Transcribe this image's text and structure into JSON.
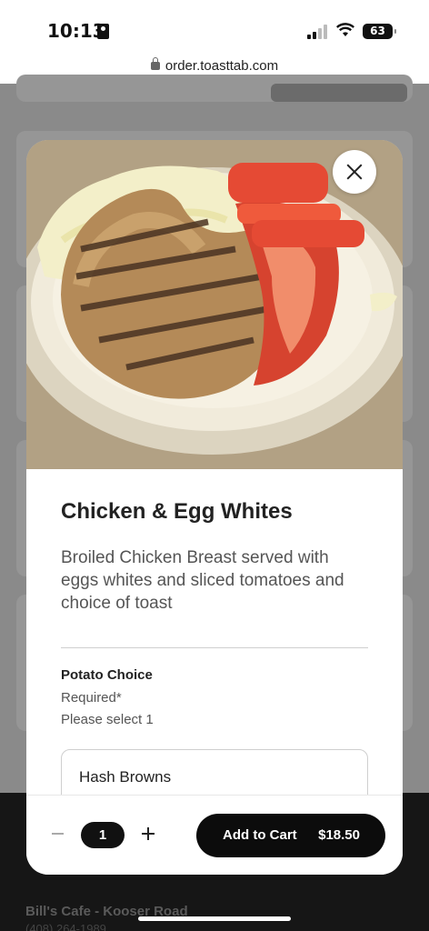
{
  "status": {
    "time": "10:13",
    "battery": "63"
  },
  "browser": {
    "url": "order.toasttab.com"
  },
  "background": {
    "restaurant": "Bill's Cafe - Kooser Road",
    "phone": "(408) 264-1989"
  },
  "item": {
    "title": "Chicken & Egg Whites",
    "description": "Broiled Chicken Breast served with eggs whites and sliced tomatoes and choice of toast",
    "image_icon": "dish-photo"
  },
  "modifier": {
    "title": "Potato Choice",
    "required": "Required*",
    "instruction": "Please select 1",
    "options": [
      "Hash Browns"
    ]
  },
  "cart": {
    "quantity": "1",
    "add_label": "Add to Cart",
    "price": "$18.50"
  },
  "colors": {
    "button": "#0c0c0c",
    "overlay": "#8a8a8a",
    "plate": "#efe9d8",
    "tomato": "#e8443a"
  }
}
